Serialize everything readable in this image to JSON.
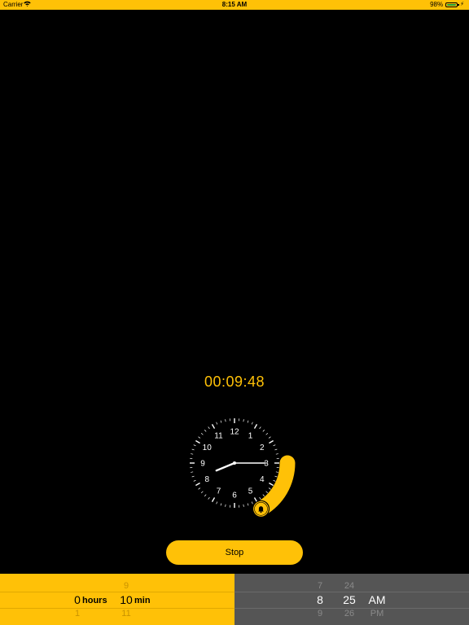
{
  "status_bar": {
    "carrier": "Carrier",
    "time": "8:15 AM",
    "battery": "98%"
  },
  "timer": {
    "countdown": "00:09:48"
  },
  "clock": {
    "numbers": [
      "12",
      "1",
      "2",
      "3",
      "4",
      "5",
      "6",
      "7",
      "8",
      "9",
      "10",
      "11"
    ],
    "hour": 8,
    "minute": 15,
    "second": 0
  },
  "stop_label": "Stop",
  "duration_picker": {
    "hours": {
      "above": "",
      "selected": "0",
      "below": "1",
      "unit": "hours"
    },
    "minutes": {
      "above": "9",
      "selected": "10",
      "below": "11",
      "unit": "min"
    }
  },
  "time_picker": {
    "hour": {
      "above": "7",
      "selected": "8",
      "below": "9"
    },
    "minute": {
      "above": "24",
      "selected": "25",
      "below": "26"
    },
    "period": {
      "above": "",
      "selected": "AM",
      "below": "PM"
    }
  },
  "colors": {
    "accent": "#FFC107",
    "background": "#000000",
    "picker_gray": "#555555"
  }
}
